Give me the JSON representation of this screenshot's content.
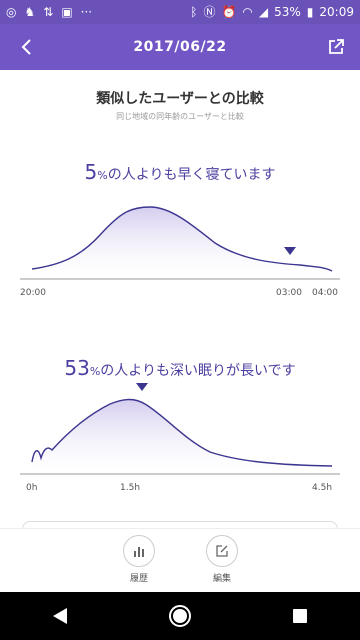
{
  "status": {
    "battery": "53%",
    "time": "20:09",
    "left_icons": [
      "whatsapp-icon",
      "evernote-icon",
      "arrows-icon",
      "image-icon",
      "more-icon"
    ],
    "right_icons": [
      "bluetooth-icon",
      "nfc-icon",
      "alarm-icon",
      "wifi-icon",
      "signal-icon",
      "battery-icon"
    ]
  },
  "header": {
    "title": "2017/06/22"
  },
  "comparison": {
    "heading": "類似したユーザーとの比較",
    "subheading": "同じ地域の同年齢のユーザーと比較"
  },
  "chart1": {
    "stat_value": "5",
    "stat_unit": "%",
    "stat_text": "の人よりも早く寝ています",
    "ticks": [
      "20:00",
      "03:00",
      "04:00"
    ]
  },
  "chart2": {
    "stat_value": "53",
    "stat_unit": "%",
    "stat_text": "の人よりも深い眠りが長いです",
    "ticks": [
      "0h",
      "1.5h",
      "4.5h"
    ]
  },
  "toolbar": {
    "history_label": "履歴",
    "edit_label": "編集"
  },
  "colors": {
    "primary": "#7256c6",
    "status_bar": "#6a52b8",
    "curve": "#3b3590",
    "stat_text": "#4a3fa0"
  }
}
